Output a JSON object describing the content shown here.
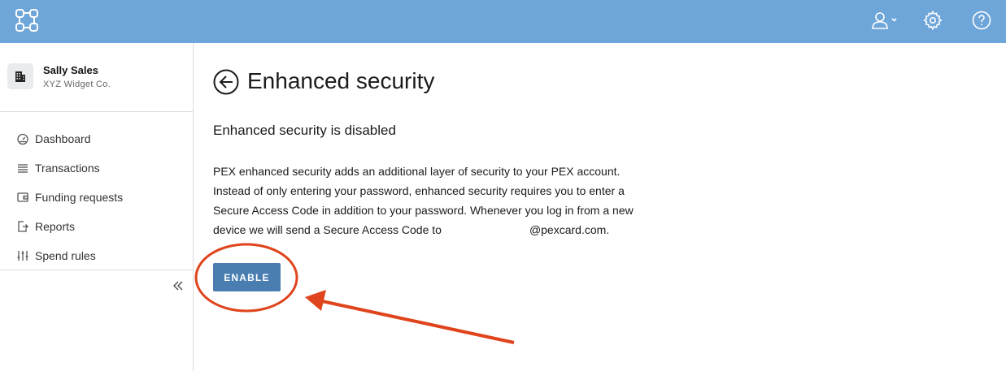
{
  "header": {
    "logo_icon": "grid-logo-icon",
    "user_icon": "user-menu-icon",
    "settings_icon": "gear-icon",
    "help_icon": "help-icon",
    "brand_color": "#6fa6d9"
  },
  "sidebar": {
    "profile": {
      "name": "Sally Sales",
      "company": "XYZ Widget Co.",
      "avatar_icon": "building-icon"
    },
    "items": [
      {
        "label": "Dashboard",
        "icon": "dashboard-icon"
      },
      {
        "label": "Transactions",
        "icon": "list-icon"
      },
      {
        "label": "Funding requests",
        "icon": "wallet-icon"
      },
      {
        "label": "Reports",
        "icon": "report-icon"
      },
      {
        "label": "Spend rules",
        "icon": "sliders-icon"
      }
    ],
    "collapse_icon": "double-chevron-left-icon"
  },
  "main": {
    "title": "Enhanced security",
    "back_icon": "back-arrow-icon",
    "status": "Enhanced security is disabled",
    "description_lines": [
      "PEX enhanced security adds an additional layer of security to your PEX account.",
      "Instead of only entering your password, enhanced security requires you to enter a",
      "Secure Access Code in addition to your password. Whenever you log in from a new",
      "device we will send a Secure Access Code to"
    ],
    "email_domain": "@pexcard.com.",
    "enable_label": "ENABLE",
    "button_color": "#4a7eb1"
  },
  "annotation": {
    "color": "#e0441c",
    "shapes": [
      "highlight-circle",
      "pointer-arrow"
    ]
  }
}
